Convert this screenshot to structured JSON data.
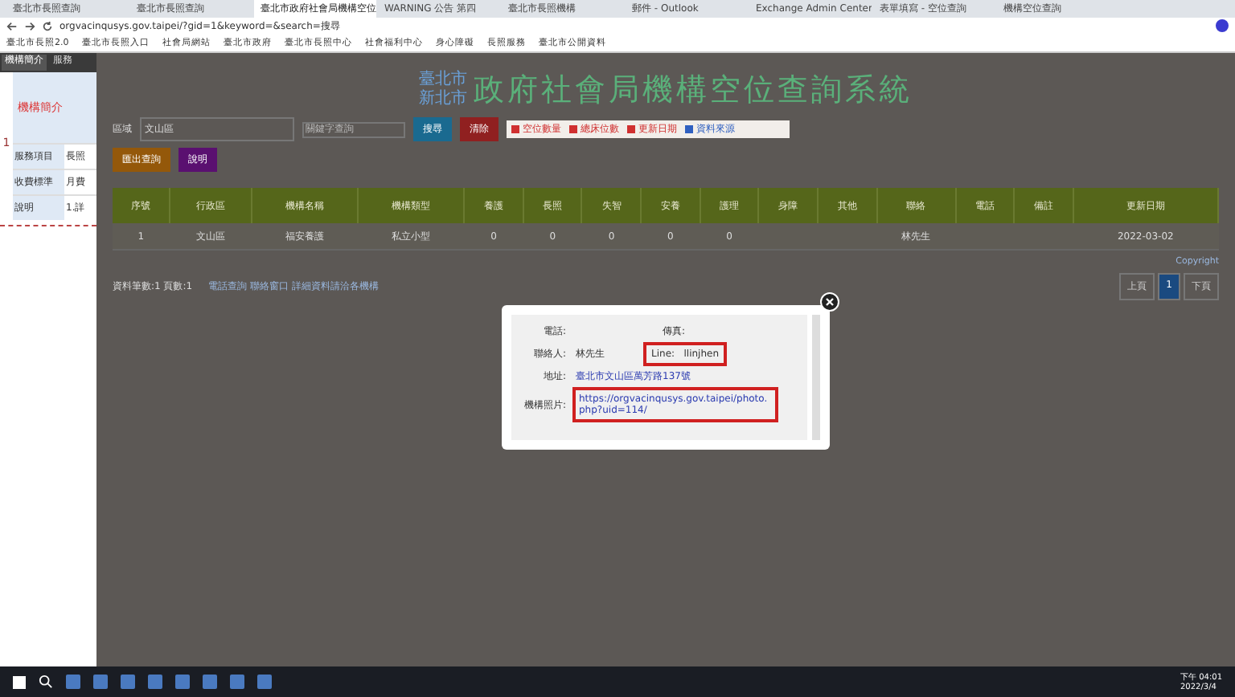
{
  "browser": {
    "tabs": [
      {
        "title": "臺北市長照查詢",
        "selected": false
      },
      {
        "title": "臺北市長照查詢",
        "selected": false
      },
      {
        "title": "臺北市政府社會局機構空位",
        "selected": true
      },
      {
        "title": "WARNING 公告 第四",
        "selected": false
      },
      {
        "title": "臺北市長照機構",
        "selected": false
      },
      {
        "title": "郵件 - Outlook",
        "selected": false
      },
      {
        "title": "Exchange Admin Center",
        "selected": false
      },
      {
        "title": "表單填寫 - 空位查詢",
        "selected": false
      },
      {
        "title": "機構空位查詢",
        "selected": false
      }
    ],
    "url": "orgvacinqusys.gov.taipei/?gid=1&keyword=&search=搜尋",
    "bookmarks": [
      "臺北市長照2.0",
      "臺北市長照入口",
      "社會局網站",
      "臺北市政府",
      "臺北市長照中心",
      "社會福利中心",
      "身心障礙",
      "長照服務",
      "臺北市公開資料"
    ]
  },
  "side_panel": {
    "tabs": [
      {
        "label": "機構簡介",
        "selected": true
      },
      {
        "label": "服務",
        "selected": false
      }
    ],
    "heading": "機構簡介",
    "row_number": "1",
    "rows": [
      {
        "label": "服務項目",
        "value": "長照"
      },
      {
        "label": "收費標準",
        "value": "月費"
      },
      {
        "label": "說明",
        "value": "1.詳"
      }
    ]
  },
  "page": {
    "city_lines": [
      "臺北市",
      "新北市"
    ],
    "title": "政府社會局機構空位查詢系統",
    "filter": {
      "label": "區域",
      "value": "文山區",
      "keyword_placeholder": "關鍵字查詢"
    },
    "buttons": [
      {
        "label": "搜尋",
        "kind": "search"
      },
      {
        "label": "清除",
        "kind": "clear"
      },
      {
        "label": "匯出查詢",
        "kind": "export"
      },
      {
        "label": "說明",
        "kind": "help"
      }
    ],
    "legend": [
      {
        "text": "空位數量",
        "color": "#d03030"
      },
      {
        "text": "總床位數",
        "color": "#d03030"
      },
      {
        "text": "更新日期",
        "color": "#d03030"
      },
      {
        "text": "資料來源",
        "color": "#3060c0"
      }
    ],
    "table": {
      "columns": [
        "序號",
        "行政區",
        "機構名稱",
        "機構類型",
        "養護",
        "長照",
        "失智",
        "安養",
        "護理",
        "身障",
        "其他",
        "聯絡",
        "電話",
        "備註",
        "更新日期"
      ],
      "rows": [
        [
          "1",
          "文山區",
          "福安養護",
          "私立小型",
          "0",
          "0",
          "0",
          "0",
          "0",
          "",
          "",
          "林先生",
          "",
          "",
          "2022-03-02"
        ]
      ]
    },
    "note": "Copyright",
    "summary": "資料筆數:1 頁數:1",
    "summary_link": "電話查詢 聯絡窗口 詳細資料請洽各機構",
    "pages": [
      {
        "label": "上頁",
        "selected": false
      },
      {
        "label": "1",
        "selected": true
      },
      {
        "label": "下頁",
        "selected": false
      }
    ]
  },
  "dialog": {
    "fields": [
      {
        "label": "電話:",
        "extra_label": "傳真:"
      },
      {
        "label": "聯絡人:",
        "value": "林先生",
        "line_label": "Line:",
        "line_value": "llinjhen",
        "highlighted": true
      },
      {
        "label": "地址:",
        "value": "臺北市文山區萬芳路137號",
        "link": true
      },
      {
        "label": "機構照片:",
        "value": "https://orgvacinqusys.gov.taipei/photo.php?uid=114/",
        "link": true,
        "highlighted": true
      }
    ]
  },
  "taskbar": {
    "time": "下午 04:01",
    "date": "2022/3/4"
  }
}
